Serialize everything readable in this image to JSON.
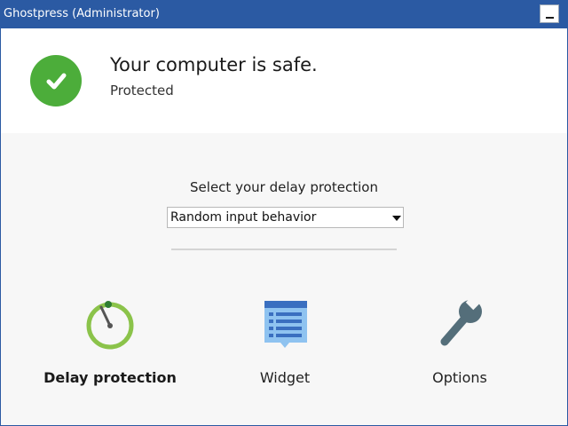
{
  "window": {
    "title": "Ghostpress (Administrator)"
  },
  "status": {
    "title": "Your computer is safe.",
    "subtitle": "Protected",
    "icon": "check-icon",
    "color": "#4cad3a"
  },
  "protection": {
    "label": "Select your delay protection",
    "selected": "Random input behavior"
  },
  "features": [
    {
      "label": "Delay protection",
      "icon": "gauge-icon",
      "active": true
    },
    {
      "label": "Widget",
      "icon": "widget-icon",
      "active": false
    },
    {
      "label": "Options",
      "icon": "wrench-icon",
      "active": false
    }
  ],
  "colors": {
    "titlebar": "#2b5aa3",
    "accent_green": "#4cad3a",
    "widget_blue": "#4a90d9",
    "wrench_gray": "#546e7a"
  }
}
